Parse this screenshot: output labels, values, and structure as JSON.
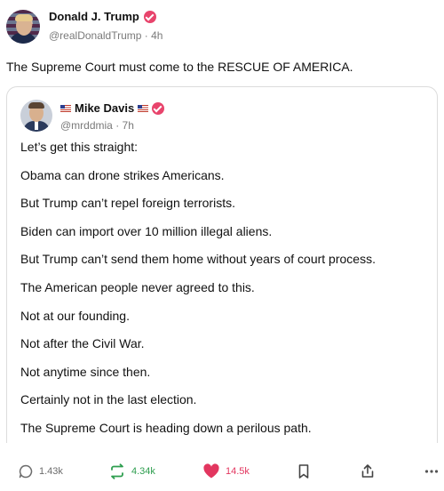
{
  "post": {
    "author_name": "Donald J. Trump",
    "handle": "@realDonaldTrump",
    "time": "4h",
    "text": "The Supreme Court must come to the RESCUE OF AMERICA."
  },
  "quote": {
    "author_name": "Mike Davis",
    "handle": "@mrddmia",
    "time": "7h",
    "lines": [
      "Let’s get this straight:",
      "Obama can drone strikes Americans.",
      "But Trump can’t repel foreign terrorists.",
      "Biden can import over 10 million illegal aliens.",
      "But Trump can’t send them home without years of court process.",
      "The American people never agreed to this.",
      "Not at our founding.",
      "Not after the Civil War.",
      "Not anytime since then.",
      "Certainly not in the last election.",
      "The Supreme Court is heading down a perilous path."
    ]
  },
  "actions": {
    "replies": "1.43k",
    "reposts": "4.34k",
    "likes": "14.5k"
  },
  "colors": {
    "verified_badge": "#e8446c",
    "repost_green": "#2e9e4f",
    "like_red": "#e2365f",
    "meta_gray": "#7a7a7a"
  },
  "icons": [
    "verified-icon",
    "us-flag-icon",
    "reply-icon",
    "repost-icon",
    "heart-icon",
    "bookmark-icon",
    "share-icon",
    "more-icon"
  ]
}
